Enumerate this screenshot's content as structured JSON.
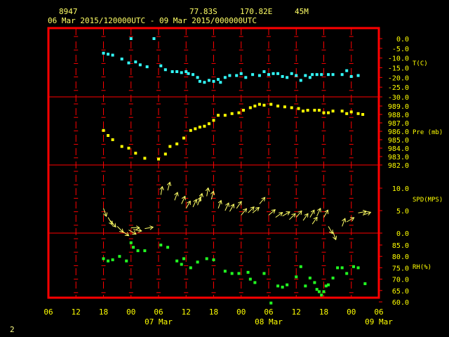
{
  "header": {
    "station_id": "8947",
    "latitude": "77.83S",
    "longitude": "170.82E",
    "elevation": "45M",
    "time_range": "06 Mar 2015/120000UTC - 09 Mar 2015/000000UTC"
  },
  "footer": {
    "page_number": "2"
  },
  "colors": {
    "frame": "#ff0000",
    "grid": "#ff0000",
    "label_text": "#ffff00",
    "temperature": "#33ffff",
    "pressure": "#ffff00",
    "wind": "#ffff66",
    "humidity": "#22ff22"
  },
  "chart_data": {
    "type": "scatter",
    "x_axis": {
      "unit": "hour since 06 Mar 00UTC",
      "range": [
        0,
        72
      ],
      "tick_labels": [
        "06",
        "12",
        "18",
        "00",
        "06",
        "12",
        "18",
        "00",
        "06",
        "12",
        "18",
        "00",
        "06"
      ],
      "date_labels": [
        {
          "hour": 24,
          "label": "07 Mar"
        },
        {
          "hour": 48,
          "label": "08 Mar"
        },
        {
          "hour": 72,
          "label": "09 Mar"
        }
      ]
    },
    "panels": [
      {
        "id": "temperature",
        "label": "T(C)",
        "ylim": [
          -30,
          0
        ],
        "tick_labels": [
          "0.0",
          "-5.0",
          "-10.0",
          "-15.0",
          "-20.0",
          "-25.0",
          "-30.0"
        ],
        "tick_values": [
          0,
          -5,
          -10,
          -15,
          -20,
          -25,
          -30
        ],
        "series": [
          {
            "hour": 12,
            "value": -7.5
          },
          {
            "hour": 13,
            "value": -8.0
          },
          {
            "hour": 14,
            "value": -8.5
          },
          {
            "hour": 16,
            "value": -10.5
          },
          {
            "hour": 17.5,
            "value": -12.5
          },
          {
            "hour": 18,
            "value": 0.0
          },
          {
            "hour": 19,
            "value": -12.0
          },
          {
            "hour": 20,
            "value": -13.5
          },
          {
            "hour": 21.5,
            "value": -14.5
          },
          {
            "hour": 23,
            "value": 0.0
          },
          {
            "hour": 24.5,
            "value": -14.0
          },
          {
            "hour": 25.5,
            "value": -16.0
          },
          {
            "hour": 27,
            "value": -17.0
          },
          {
            "hour": 28,
            "value": -17.0
          },
          {
            "hour": 29,
            "value": -17.5
          },
          {
            "hour": 30,
            "value": -17.0
          },
          {
            "hour": 30.5,
            "value": -18.0
          },
          {
            "hour": 31.5,
            "value": -18.5
          },
          {
            "hour": 32.5,
            "value": -20.0
          },
          {
            "hour": 33,
            "value": -22.0
          },
          {
            "hour": 34,
            "value": -22.5
          },
          {
            "hour": 35,
            "value": -21.5
          },
          {
            "hour": 36,
            "value": -22.0
          },
          {
            "hour": 37,
            "value": -21.0
          },
          {
            "hour": 37.5,
            "value": -22.5
          },
          {
            "hour": 38.5,
            "value": -20.0
          },
          {
            "hour": 39.5,
            "value": -19.0
          },
          {
            "hour": 41,
            "value": -19.0
          },
          {
            "hour": 42,
            "value": -18.0
          },
          {
            "hour": 43,
            "value": -20.0
          },
          {
            "hour": 44.5,
            "value": -18.5
          },
          {
            "hour": 46,
            "value": -19.0
          },
          {
            "hour": 47,
            "value": -17.0
          },
          {
            "hour": 48,
            "value": -18.5
          },
          {
            "hour": 49,
            "value": -18.0
          },
          {
            "hour": 50,
            "value": -18.0
          },
          {
            "hour": 51,
            "value": -19.5
          },
          {
            "hour": 52,
            "value": -20.0
          },
          {
            "hour": 53,
            "value": -18.0
          },
          {
            "hour": 54,
            "value": -19.0
          },
          {
            "hour": 55,
            "value": -21.5
          },
          {
            "hour": 56,
            "value": -19.0
          },
          {
            "hour": 57,
            "value": -20.0
          },
          {
            "hour": 57.5,
            "value": -18.5
          },
          {
            "hour": 58.5,
            "value": -18.5
          },
          {
            "hour": 59.5,
            "value": -18.5
          },
          {
            "hour": 61,
            "value": -18.5
          },
          {
            "hour": 62,
            "value": -18.5
          },
          {
            "hour": 64,
            "value": -18.5
          },
          {
            "hour": 65,
            "value": -16.5
          },
          {
            "hour": 66,
            "value": -19.5
          },
          {
            "hour": 67.5,
            "value": -19.0
          }
        ]
      },
      {
        "id": "pressure",
        "label": "Pre (mb)",
        "ylim": [
          982,
          989.9
        ],
        "tick_labels": [
          "989.0",
          "988.0",
          "987.0",
          "986.0",
          "985.0",
          "984.0",
          "983.0",
          "982.0"
        ],
        "tick_values": [
          989,
          988,
          987,
          986,
          985,
          984,
          983,
          982
        ],
        "series": [
          {
            "hour": 12,
            "value": 986.1
          },
          {
            "hour": 13,
            "value": 985.5
          },
          {
            "hour": 14,
            "value": 985.0
          },
          {
            "hour": 16,
            "value": 984.2
          },
          {
            "hour": 17.5,
            "value": 984.0
          },
          {
            "hour": 19,
            "value": 983.4
          },
          {
            "hour": 21,
            "value": 982.8
          },
          {
            "hour": 24,
            "value": 982.7
          },
          {
            "hour": 25.5,
            "value": 983.3
          },
          {
            "hour": 26.5,
            "value": 984.2
          },
          {
            "hour": 28,
            "value": 984.5
          },
          {
            "hour": 29.5,
            "value": 985.2
          },
          {
            "hour": 31,
            "value": 986.1
          },
          {
            "hour": 32,
            "value": 986.3
          },
          {
            "hour": 33,
            "value": 986.5
          },
          {
            "hour": 34,
            "value": 986.6
          },
          {
            "hour": 35,
            "value": 986.9
          },
          {
            "hour": 36,
            "value": 987.3
          },
          {
            "hour": 37,
            "value": 987.9
          },
          {
            "hour": 38.5,
            "value": 987.9
          },
          {
            "hour": 40,
            "value": 988.1
          },
          {
            "hour": 41.5,
            "value": 988.2
          },
          {
            "hour": 42.5,
            "value": 988.5
          },
          {
            "hour": 44,
            "value": 988.8
          },
          {
            "hour": 45,
            "value": 989.0
          },
          {
            "hour": 46,
            "value": 989.2
          },
          {
            "hour": 47,
            "value": 989.1
          },
          {
            "hour": 48.5,
            "value": 989.2
          },
          {
            "hour": 50,
            "value": 989.0
          },
          {
            "hour": 51.5,
            "value": 988.9
          },
          {
            "hour": 53,
            "value": 988.8
          },
          {
            "hour": 54.5,
            "value": 988.7
          },
          {
            "hour": 55.5,
            "value": 988.4
          },
          {
            "hour": 56.5,
            "value": 988.5
          },
          {
            "hour": 58,
            "value": 988.5
          },
          {
            "hour": 59,
            "value": 988.5
          },
          {
            "hour": 60,
            "value": 988.2
          },
          {
            "hour": 61,
            "value": 988.2
          },
          {
            "hour": 62,
            "value": 988.4
          },
          {
            "hour": 64,
            "value": 988.4
          },
          {
            "hour": 65,
            "value": 988.1
          },
          {
            "hour": 66,
            "value": 988.3
          },
          {
            "hour": 67.5,
            "value": 988.1
          },
          {
            "hour": 68.5,
            "value": 988.0
          }
        ]
      },
      {
        "id": "wind",
        "label": "SPD(MPS)",
        "ylim": [
          0,
          12
        ],
        "tick_labels": [
          "10.0",
          "5.0",
          "0.0"
        ],
        "tick_values": [
          10,
          5,
          0
        ],
        "series": [
          {
            "hour": 12,
            "value": 5.5,
            "dir_deg": 160
          },
          {
            "hour": 13,
            "value": 3.5,
            "dir_deg": 150
          },
          {
            "hour": 13.5,
            "value": 2.8,
            "dir_deg": 140
          },
          {
            "hour": 15,
            "value": 1.5,
            "dir_deg": 135
          },
          {
            "hour": 16,
            "value": 0.5,
            "dir_deg": 125
          },
          {
            "hour": 17.5,
            "value": 0.7,
            "dir_deg": 120
          },
          {
            "hour": 18,
            "value": 1.2,
            "dir_deg": 90
          },
          {
            "hour": 18.5,
            "value": 0.8,
            "dir_deg": 100
          },
          {
            "hour": 21,
            "value": 1.0,
            "dir_deg": 80
          },
          {
            "hour": 24.5,
            "value": 8.5,
            "dir_deg": 10
          },
          {
            "hour": 26,
            "value": 9.5,
            "dir_deg": 15
          },
          {
            "hour": 27.5,
            "value": 7.3,
            "dir_deg": 20
          },
          {
            "hour": 29,
            "value": 6.5,
            "dir_deg": 25
          },
          {
            "hour": 30,
            "value": 5.5,
            "dir_deg": 30
          },
          {
            "hour": 31.5,
            "value": 5.8,
            "dir_deg": 25
          },
          {
            "hour": 32.5,
            "value": 6.2,
            "dir_deg": 20
          },
          {
            "hour": 33,
            "value": 7.0,
            "dir_deg": 15
          },
          {
            "hour": 34.5,
            "value": 8.2,
            "dir_deg": 10
          },
          {
            "hour": 35.5,
            "value": 7.5,
            "dir_deg": 15
          },
          {
            "hour": 37,
            "value": 5.5,
            "dir_deg": 20
          },
          {
            "hour": 38.5,
            "value": 5.0,
            "dir_deg": 25
          },
          {
            "hour": 39.5,
            "value": 4.8,
            "dir_deg": 30
          },
          {
            "hour": 41,
            "value": 5.5,
            "dir_deg": 35
          },
          {
            "hour": 42,
            "value": 4.0,
            "dir_deg": 40
          },
          {
            "hour": 43.5,
            "value": 4.5,
            "dir_deg": 45
          },
          {
            "hour": 44.5,
            "value": 4.5,
            "dir_deg": 50
          },
          {
            "hour": 46,
            "value": 6.5,
            "dir_deg": 40
          },
          {
            "hour": 48,
            "value": 4.0,
            "dir_deg": 50
          },
          {
            "hour": 49.5,
            "value": 3.5,
            "dir_deg": 55
          },
          {
            "hour": 51,
            "value": 3.8,
            "dir_deg": 60
          },
          {
            "hour": 52.5,
            "value": 3.0,
            "dir_deg": 45
          },
          {
            "hour": 54,
            "value": 3.5,
            "dir_deg": 40
          },
          {
            "hour": 55.5,
            "value": 2.8,
            "dir_deg": 35
          },
          {
            "hour": 57,
            "value": 3.5,
            "dir_deg": 30
          },
          {
            "hour": 57.5,
            "value": 2.0,
            "dir_deg": 35
          },
          {
            "hour": 58.5,
            "value": 3.8,
            "dir_deg": 25
          },
          {
            "hour": 60,
            "value": 3.5,
            "dir_deg": 30
          },
          {
            "hour": 61,
            "value": 1.5,
            "dir_deg": 150
          },
          {
            "hour": 62,
            "value": 0.3,
            "dir_deg": 160
          },
          {
            "hour": 64,
            "value": 1.5,
            "dir_deg": 20
          },
          {
            "hour": 65,
            "value": 2.5,
            "dir_deg": 60
          },
          {
            "hour": 67.5,
            "value": 4.5,
            "dir_deg": 80
          },
          {
            "hour": 68.5,
            "value": 4.0,
            "dir_deg": 70
          }
        ]
      },
      {
        "id": "humidity",
        "label": "RH(%)",
        "ylim": [
          60,
          90
        ],
        "tick_labels": [
          "85.0",
          "80.0",
          "75.0",
          "70.0",
          "65.0",
          "60.0"
        ],
        "tick_values": [
          85,
          80,
          75,
          70,
          65,
          60
        ],
        "series": [
          {
            "hour": 12,
            "value": 79.0
          },
          {
            "hour": 13,
            "value": 78.0
          },
          {
            "hour": 14,
            "value": 78.5
          },
          {
            "hour": 15.5,
            "value": 80.0
          },
          {
            "hour": 17,
            "value": 78.0
          },
          {
            "hour": 18,
            "value": 86.0
          },
          {
            "hour": 18.5,
            "value": 84.0
          },
          {
            "hour": 19.5,
            "value": 82.5
          },
          {
            "hour": 21,
            "value": 82.5
          },
          {
            "hour": 24.5,
            "value": 85.0
          },
          {
            "hour": 26,
            "value": 84.0
          },
          {
            "hour": 28,
            "value": 78.0
          },
          {
            "hour": 29,
            "value": 76.5
          },
          {
            "hour": 29.5,
            "value": 79.0
          },
          {
            "hour": 31,
            "value": 75.0
          },
          {
            "hour": 32.5,
            "value": 77.5
          },
          {
            "hour": 34.5,
            "value": 79.0
          },
          {
            "hour": 36,
            "value": 78.5
          },
          {
            "hour": 38.5,
            "value": 73.5
          },
          {
            "hour": 40,
            "value": 72.5
          },
          {
            "hour": 41.5,
            "value": 72.5
          },
          {
            "hour": 43.5,
            "value": 73.0
          },
          {
            "hour": 44,
            "value": 70.0
          },
          {
            "hour": 45,
            "value": 68.5
          },
          {
            "hour": 47,
            "value": 72.5
          },
          {
            "hour": 48.5,
            "value": 59.5
          },
          {
            "hour": 50,
            "value": 67.0
          },
          {
            "hour": 51,
            "value": 66.5
          },
          {
            "hour": 52,
            "value": 67.5
          },
          {
            "hour": 54,
            "value": 71.0
          },
          {
            "hour": 55,
            "value": 75.5
          },
          {
            "hour": 56,
            "value": 67.0
          },
          {
            "hour": 57,
            "value": 70.5
          },
          {
            "hour": 58,
            "value": 68.5
          },
          {
            "hour": 58.5,
            "value": 65.5
          },
          {
            "hour": 59,
            "value": 64.5
          },
          {
            "hour": 59.5,
            "value": 63.0
          },
          {
            "hour": 60,
            "value": 64.5
          },
          {
            "hour": 60.5,
            "value": 67.0
          },
          {
            "hour": 61,
            "value": 67.5
          },
          {
            "hour": 62,
            "value": 70.5
          },
          {
            "hour": 63,
            "value": 75.0
          },
          {
            "hour": 64,
            "value": 75.0
          },
          {
            "hour": 65,
            "value": 72.5
          },
          {
            "hour": 66.5,
            "value": 75.5
          },
          {
            "hour": 67.5,
            "value": 75.0
          },
          {
            "hour": 69,
            "value": 68.0
          }
        ]
      }
    ]
  }
}
